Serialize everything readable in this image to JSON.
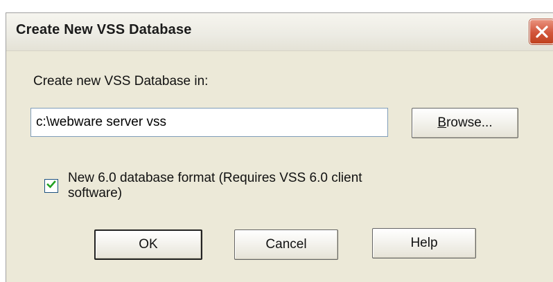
{
  "window": {
    "title": "Create New VSS Database"
  },
  "form": {
    "location_label": "Create new VSS Database in:",
    "location_value": "c:\\webware server vss",
    "format_checkbox_label": "New 6.0 database format (Requires VSS 6.0 client software)",
    "format_checked": true
  },
  "buttons": {
    "browse_mnemonic": "B",
    "browse_rest": "rowse...",
    "ok": "OK",
    "cancel": "Cancel",
    "help": "Help"
  },
  "icons": {
    "close": "close-icon",
    "check": "checkmark-icon"
  },
  "colors": {
    "dialog_background": "#ece9d8",
    "close_button": "#d2543a",
    "input_border": "#7f9db9"
  }
}
